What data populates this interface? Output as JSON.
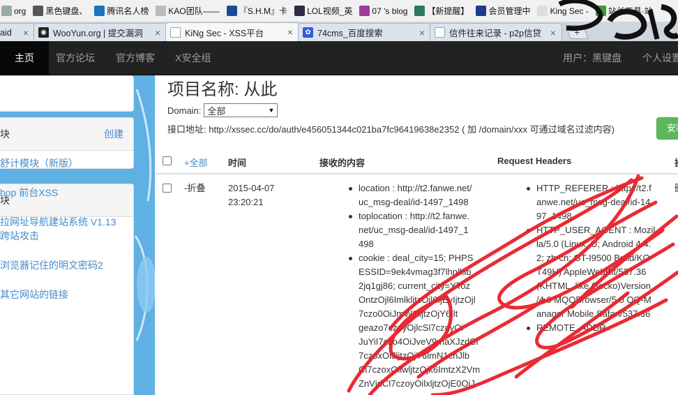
{
  "bookmarks": [
    {
      "label": "org",
      "icon": "blank-page-icon",
      "color": "#9aa"
    },
    {
      "label": "黑色键盘、",
      "icon": "star-icon",
      "color": "#555"
    },
    {
      "label": "腾讯名人榜",
      "icon": "shield-icon",
      "color": "#1e73be"
    },
    {
      "label": "KAO团队——",
      "icon": "blank-page-icon",
      "color": "#bbb"
    },
    {
      "label": "『S.H.M』卡",
      "icon": "tian-icon",
      "color": "#1a4c9a"
    },
    {
      "label": "LOL视频_英",
      "icon": "lol-icon",
      "color": "#2b2b4a"
    },
    {
      "label": "07 's blog",
      "icon": "qing-icon",
      "color": "#a03a9a"
    },
    {
      "label": "【新提醒】",
      "icon": "security-icon",
      "color": "#2a7a5a"
    },
    {
      "label": "会员管理中",
      "icon": "butterfly-icon",
      "color": "#1b3f8c"
    },
    {
      "label": "King Sec -",
      "icon": "blank-page-icon",
      "color": "#ddd"
    },
    {
      "label": "站长工具·站",
      "icon": "station-icon",
      "color": "#3a9a3a"
    }
  ],
  "tabs": [
    {
      "label": "aid",
      "icon": "blank-page-icon",
      "active": false
    },
    {
      "label": "WooYun.org | 提交漏洞",
      "icon": "wooyun-icon",
      "active": false
    },
    {
      "label": "KiNg Sec - XSS平台",
      "icon": "page-icon",
      "active": true
    },
    {
      "label": "74cms_百度搜索",
      "icon": "baidu-paw-icon",
      "active": false
    },
    {
      "label": "信件往来记录 - p2p信贷",
      "icon": "page-icon",
      "active": false
    }
  ],
  "newtab_label": "+",
  "navbar": {
    "home": "主页",
    "forum": "官方论坛",
    "blog": "官方博客",
    "xsec": "X安全组",
    "user": "用户：黑键盘",
    "settings": "个人设置"
  },
  "sidebar": {
    "panel1_head": "块",
    "create": "创建",
    "panel2_head": "块",
    "links": [
      [
        "舒计模块（新版）"
      ],
      [
        "hop 前台XSS"
      ],
      [
        "拉网址导航建站系统 V1.13",
        "跨站攻击"
      ],
      [
        "浏览器记住的明文密码2"
      ],
      [
        "其它网站的链接"
      ]
    ]
  },
  "main": {
    "project_title": "项目名称: 从此",
    "domain_label": "Domain:",
    "domain_selected": "全部",
    "api_text": "接口地址: http://xssec.cc/do/auth/e456051344c021ba7fc96419638e2352 ( 加 /domain/xxx 可通过域名过滤内容)",
    "install_button": "安装",
    "headers": {
      "select_all": "+全部",
      "time": "时间",
      "content": "接收的内容",
      "request_headers": "Request Headers",
      "operate": "操"
    },
    "row": {
      "collapse": "-折叠",
      "date": "2015-04-07",
      "time": "23:20:21",
      "content": [
        [
          "location : http://t2.fanwe.net/",
          "uc_msg-deal/id-1497_1498"
        ],
        [
          "toplocation : http://t2.fanwe.",
          "net/uc_msg-deal/id-1497_1",
          "498"
        ],
        [
          "cookie : deal_city=15; PHPS",
          "ESSID=9ek4vmag3f7lhnlkib",
          "2jq1gj86; current_city=YToz",
          "OntzOjl6ImlklitzOjl6IjEyIjtzOjl",
          "7czo0OiJmW1lljtzOjY6Ilt",
          "geazo7czoyOjlcSl7czoyOi",
          "JuYiI7czo4OiJveV9maXJzdCl",
          "7czoxOiJljtzOjY6lmN1cnJlb",
          "Cl7czoxOilwljtzOjk6ImtzX2Vm",
          "ZnVjdCl7czoyOilxljtzOjE0OiJ"
        ]
      ],
      "headers": [
        [
          "HTTP_REFERER : http://t2.f",
          "anwe.net/uc_msg-deal/id-14",
          "97_1498"
        ],
        [
          "HTTP_USER_AGENT : Mozil",
          "la/5.0 (Linux; U; Android 4.4.",
          "2; zh-cn; GT-I9500 Build/KO",
          "T49H) AppleWebKit/537.36",
          "(KHTML, like Gecko)Version",
          "/4.0 MQQBrowser/5.0 QQ-M",
          "anager Mobile Safari/537.36"
        ],
        [
          "REMOTE_ADDR :"
        ]
      ],
      "operate": "删"
    }
  },
  "colors": {
    "navbar_bg": "#222222",
    "link_blue": "#428bca",
    "sidebar_bg": "#5fb0e3",
    "install_green": "#5cb85c",
    "scribble_red": "#e8202a"
  }
}
